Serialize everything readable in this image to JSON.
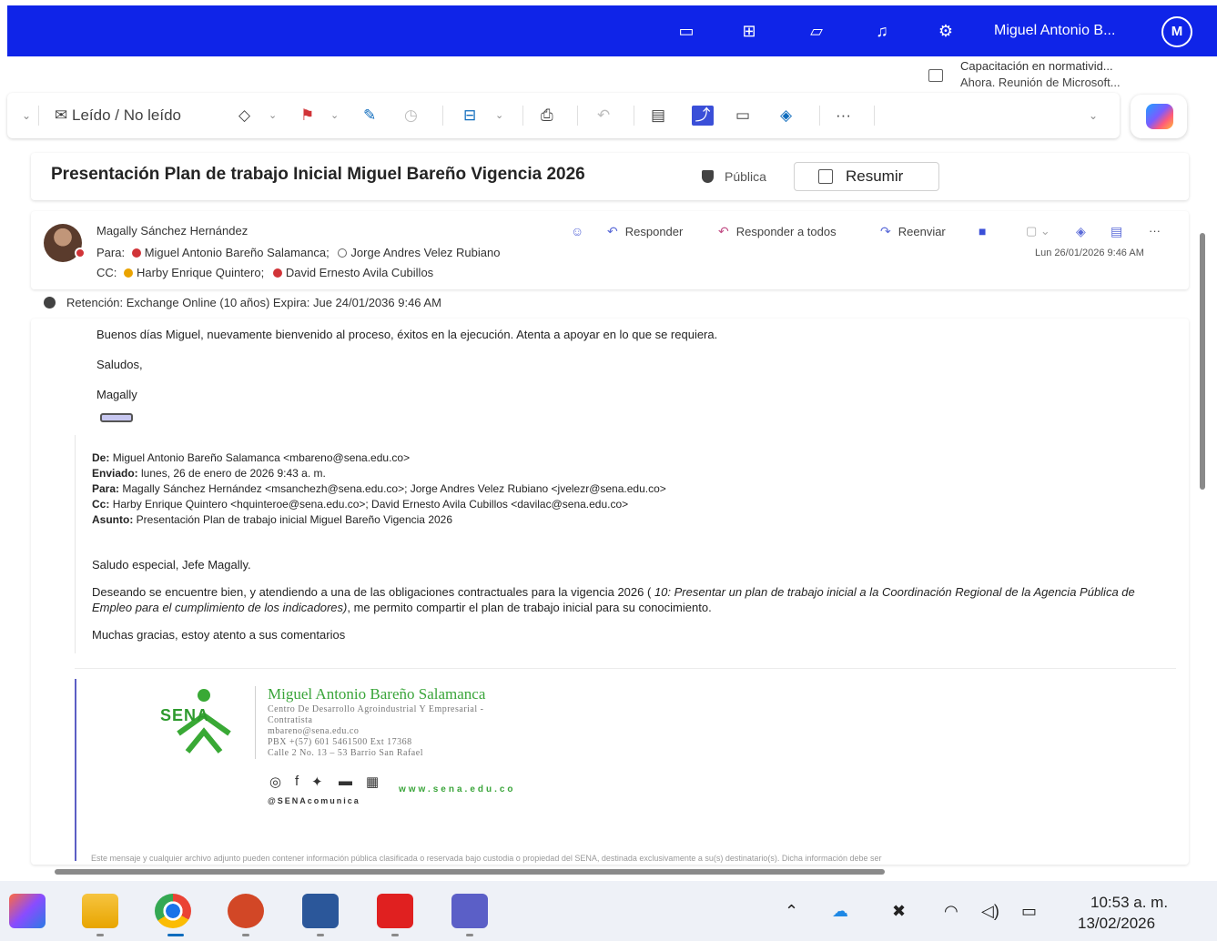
{
  "topbar": {
    "user_name": "Miguel Antonio B...",
    "avatar_initial": "M",
    "bg_color": "#0f24e8"
  },
  "notification": {
    "title": "Capacitación en normativid...",
    "subtitle": "Ahora. Reunión de Microsoft..."
  },
  "toolbar": {
    "read_unread_label": "Leído / No leído",
    "more_label": "···"
  },
  "message": {
    "subject": "Presentación Plan de trabajo Inicial Miguel Bareño Vigencia 2026",
    "sensitivity": "Pública",
    "summarize_label": "Resumir",
    "sender": "Magally Sánchez Hernández",
    "to_label": "Para:",
    "to": [
      "Miguel Antonio Bareño Salamanca;",
      "Jorge Andres Velez Rubiano"
    ],
    "cc_label": "CC:",
    "cc": [
      "Harby Enrique Quintero;",
      "David Ernesto Avila Cubillos"
    ],
    "actions": {
      "reply": "Responder",
      "reply_all": "Responder a todos",
      "forward": "Reenviar"
    },
    "date": "Lun 26/01/2026 9:46 AM",
    "retention": "Retención: Exchange Online (10 años) Expira: Jue 24/01/2036 9:46 AM"
  },
  "body": {
    "greeting": "Buenos días Miguel, nuevamente bienvenido al proceso, éxitos en la ejecución. Atenta a apoyar en lo que se requiera.",
    "closing": "Saludos,",
    "signature": "Magally"
  },
  "quoted": {
    "from_label": "De:",
    "from": "Miguel Antonio Bareño Salamanca <mbareno@sena.edu.co>",
    "sent_label": "Enviado:",
    "sent": "lunes, 26 de enero de 2026 9:43 a. m.",
    "to_label": "Para:",
    "to": "Magally Sánchez Hernández <msanchezh@sena.edu.co>; Jorge Andres Velez Rubiano <jvelezr@sena.edu.co>",
    "cc_label": "Cc:",
    "cc": "Harby Enrique Quintero <hquinteroe@sena.edu.co>; David Ernesto Avila Cubillos <davilac@sena.edu.co>",
    "subject_label": "Asunto:",
    "subject": "Presentación Plan de trabajo inicial Miguel Bareño Vigencia 2026",
    "salutation": "Saludo especial, Jefe Magally.",
    "para1_start": "Deseando se encuentre bien, y atendiendo a una de las obligaciones contractuales para la vigencia 2026 (",
    "para1_italic": " 10: Presentar un plan de trabajo inicial a la Coordinación Regional de la Agencia Pública de Empleo para el cumplimiento de los indicadores)",
    "para1_end": ", me permito compartir el plan de trabajo inicial para su conocimiento.",
    "thanks": "Muchas gracias, estoy atento a sus comentarios"
  },
  "email_signature": {
    "logo_text": "SENA",
    "name": "Miguel Antonio Bareño Salamanca",
    "line1": "Centro De Desarrollo Agroindustrial Y Empresarial -",
    "line2": "Contratista",
    "line3": "mbareno@sena.edu.co",
    "line4": "PBX +(57) 601 5461500 Ext 17368",
    "line5": "Calle 2 No. 13 – 53 Barrio San Rafael",
    "handle": "@SENAcomunica",
    "site": "www.sena.edu.co"
  },
  "disclaimer": "Este mensaje y cualquier archivo adjunto pueden contener información pública clasificada o reservada bajo custodia o propiedad del SENA, destinada exclusivamente a su(s) destinatario(s). Dicha información debe ser",
  "taskbar": {
    "time": "10:53 a. m.",
    "date": "13/02/2026"
  }
}
